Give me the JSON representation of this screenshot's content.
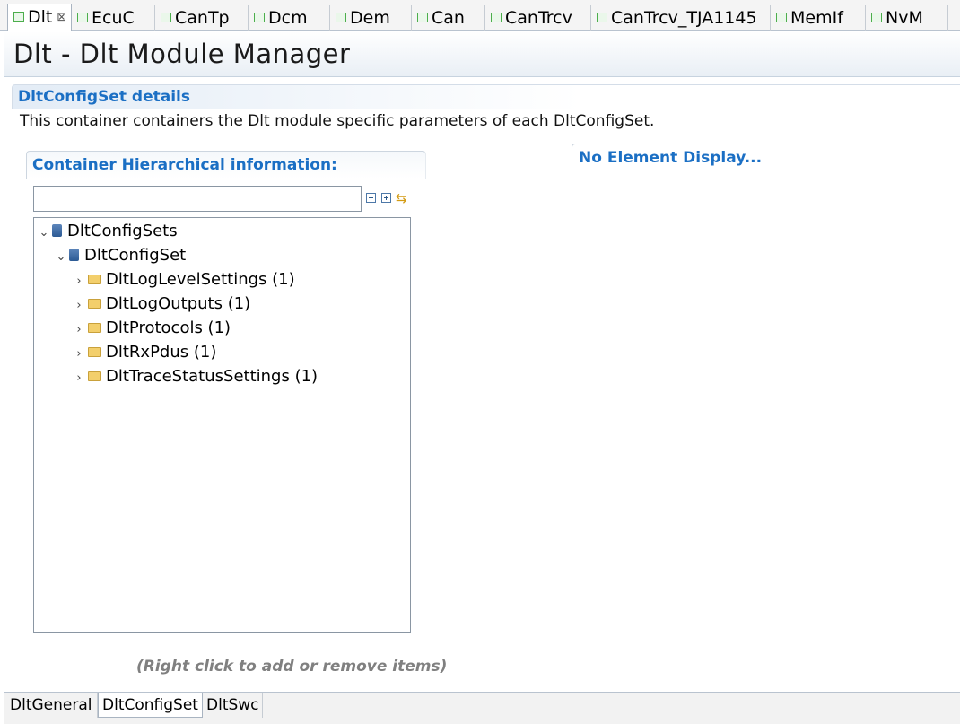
{
  "editor_tabs": [
    {
      "label": "Dlt",
      "active": true,
      "closable": true
    },
    {
      "label": "EcuC"
    },
    {
      "label": "CanTp"
    },
    {
      "label": "Dcm"
    },
    {
      "label": "Dem"
    },
    {
      "label": "Can"
    },
    {
      "label": "CanTrcv"
    },
    {
      "label": "CanTrcv_TJA1145"
    },
    {
      "label": "MemIf"
    },
    {
      "label": "NvM"
    }
  ],
  "close_glyph": "⊠",
  "header": {
    "title": "Dlt - Dlt Module Manager"
  },
  "section": {
    "title": "DltConfigSet details",
    "description": "This container containers the Dlt module specific parameters of each DltConfigSet."
  },
  "left_panel": {
    "title": "Container Hierarchical information:",
    "filter_value": "",
    "tree": [
      {
        "label": "DltConfigSets",
        "expanded": true,
        "icon": "db-icon"
      },
      {
        "label": "DltConfigSet",
        "expanded": true,
        "icon": "db-icon"
      },
      {
        "label": "DltLogLevelSettings (1)",
        "icon": "folder-icon"
      },
      {
        "label": "DltLogOutputs (1)",
        "icon": "folder-icon"
      },
      {
        "label": "DltProtocols (1)",
        "icon": "folder-icon"
      },
      {
        "label": "DltRxPdus (1)",
        "icon": "folder-icon"
      },
      {
        "label": "DltTraceStatusSettings (1)",
        "icon": "folder-icon"
      }
    ],
    "hint": "(Right click to add or remove items)"
  },
  "right_panel": {
    "title": "No Element Display..."
  },
  "bottom_tabs": [
    {
      "label": "DltGeneral"
    },
    {
      "label": "DltConfigSet",
      "active": true
    },
    {
      "label": "DltSwc"
    }
  ],
  "colors": {
    "accent": "#1b6fc4",
    "hint": "#808080"
  }
}
